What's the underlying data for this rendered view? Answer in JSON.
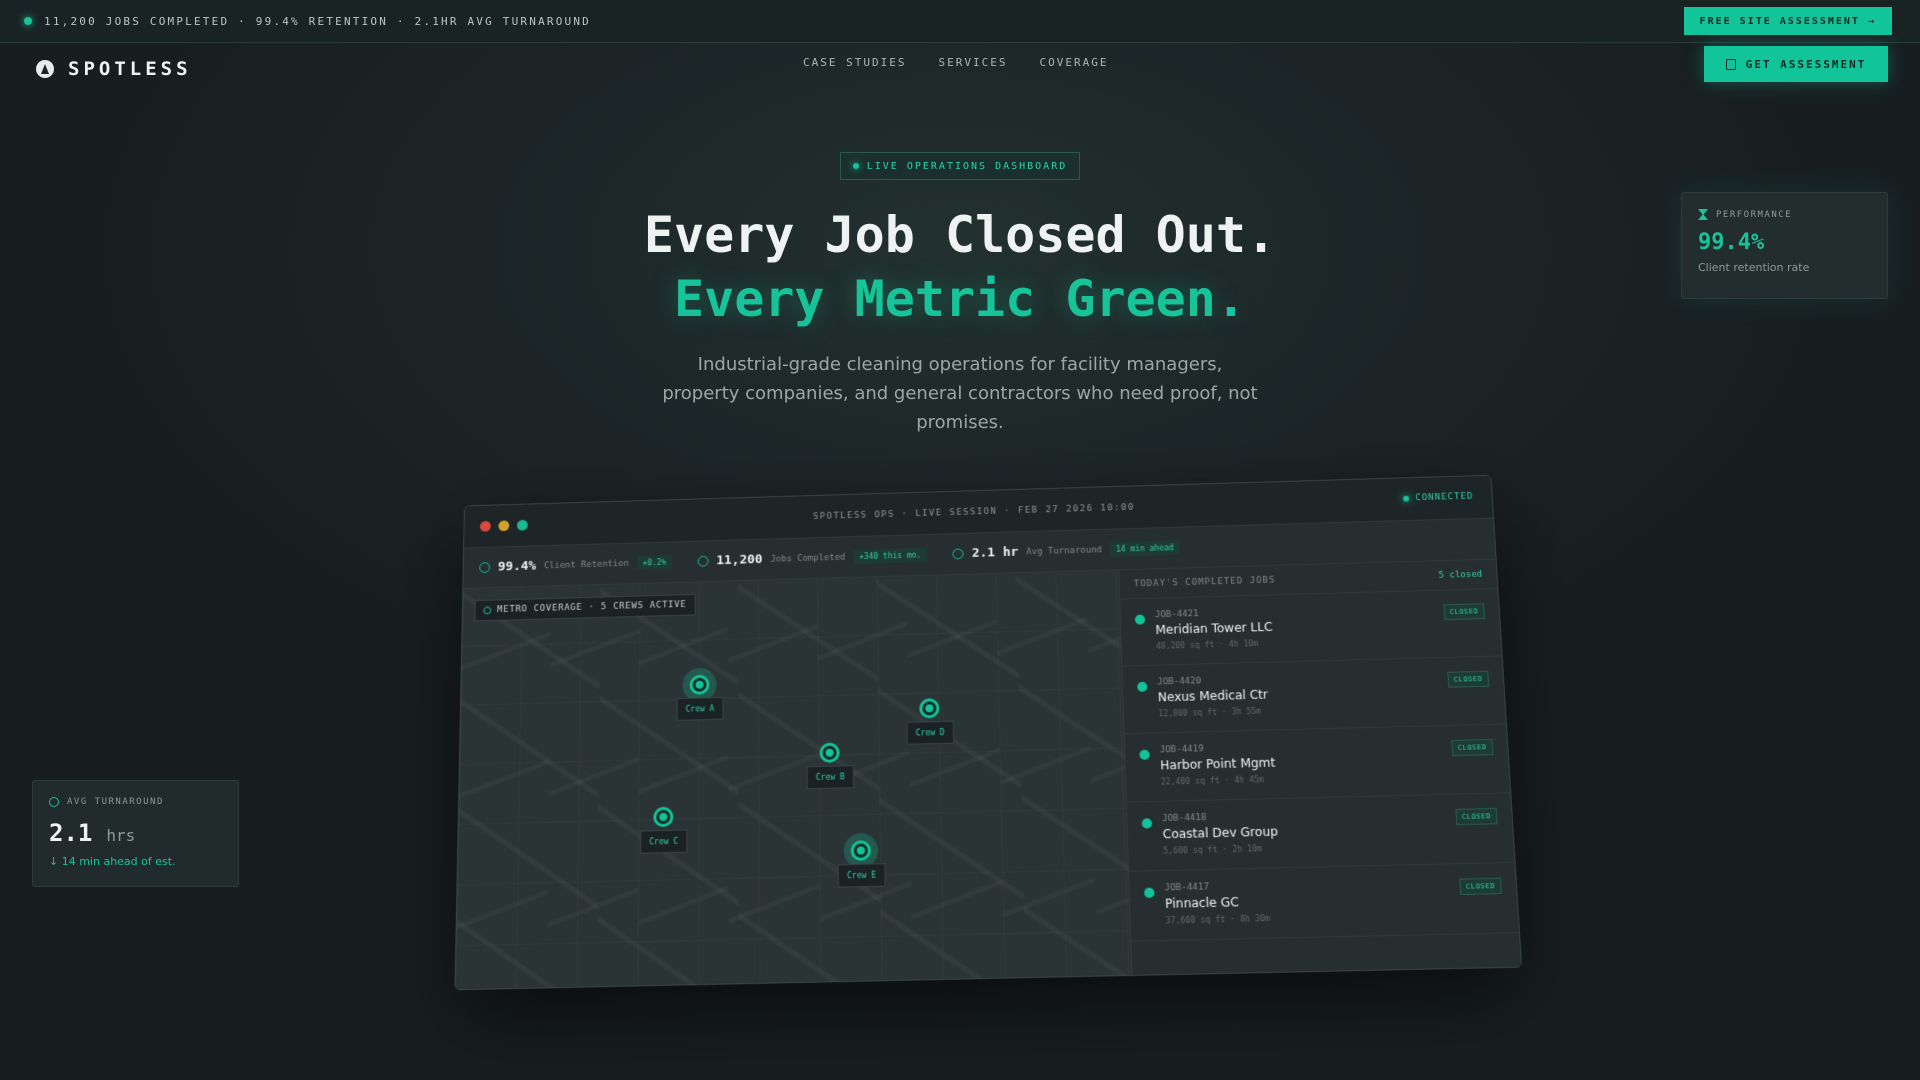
{
  "topbar": {
    "ticker": "11,200 JOBS COMPLETED · 99.4% RETENTION · 2.1HR AVG TURNAROUND",
    "cta": "FREE SITE ASSESSMENT →"
  },
  "nav": {
    "brand": "SPOTLESS",
    "links": [
      "CASE STUDIES",
      "SERVICES",
      "COVERAGE"
    ],
    "cta": "GET ASSESSMENT"
  },
  "hero": {
    "badge": "LIVE OPERATIONS DASHBOARD",
    "headline_1": "Every Job Closed Out.",
    "headline_2": "Every Metric Green.",
    "lead": "Industrial-grade cleaning operations for facility managers, property companies, and general contractors who need proof, not promises."
  },
  "performance_card": {
    "label": "PERFORMANCE",
    "value": "99.4%",
    "caption": "Client retention rate"
  },
  "turnaround_card": {
    "label": "AVG TURNAROUND",
    "value": "2.1",
    "unit": "hrs",
    "caption": "↓ 14 min ahead of est."
  },
  "dashboard": {
    "title": "SPOTLESS OPS · LIVE SESSION · FEB 27 2026 10:00",
    "status": "CONNECTED",
    "stats": [
      {
        "value": "99.4%",
        "label": "Client Retention",
        "chip": "+0.2%"
      },
      {
        "value": "11,200",
        "label": "Jobs Completed",
        "chip": "+340 this mo."
      },
      {
        "value": "2.1 hr",
        "label": "Avg Turnaround",
        "chip": "14 min ahead"
      }
    ],
    "map_tag": "METRO COVERAGE · 5 CREWS ACTIVE",
    "crews": [
      "Crew A",
      "Crew B",
      "Crew C",
      "Crew D",
      "Crew E"
    ],
    "jobs_heading": "TODAY'S COMPLETED JOBS",
    "jobs_count": "5 closed",
    "jobs": [
      {
        "id": "JOB-4421",
        "name": "Meridian Tower LLC",
        "meta": "48,200 sq ft · 4h 10m",
        "status": "CLOSED"
      },
      {
        "id": "JOB-4420",
        "name": "Nexus Medical Ctr",
        "meta": "12,800 sq ft · 3h 55m",
        "status": "CLOSED"
      },
      {
        "id": "JOB-4419",
        "name": "Harbor Point Mgmt",
        "meta": "22,400 sq ft · 4h 45m",
        "status": "CLOSED"
      },
      {
        "id": "JOB-4418",
        "name": "Coastal Dev Group",
        "meta": "5,600 sq ft · 2h 10m",
        "status": "CLOSED"
      },
      {
        "id": "JOB-4417",
        "name": "Pinnacle GC",
        "meta": "37,600 sq ft · 8h 30m",
        "status": "CLOSED"
      }
    ]
  }
}
